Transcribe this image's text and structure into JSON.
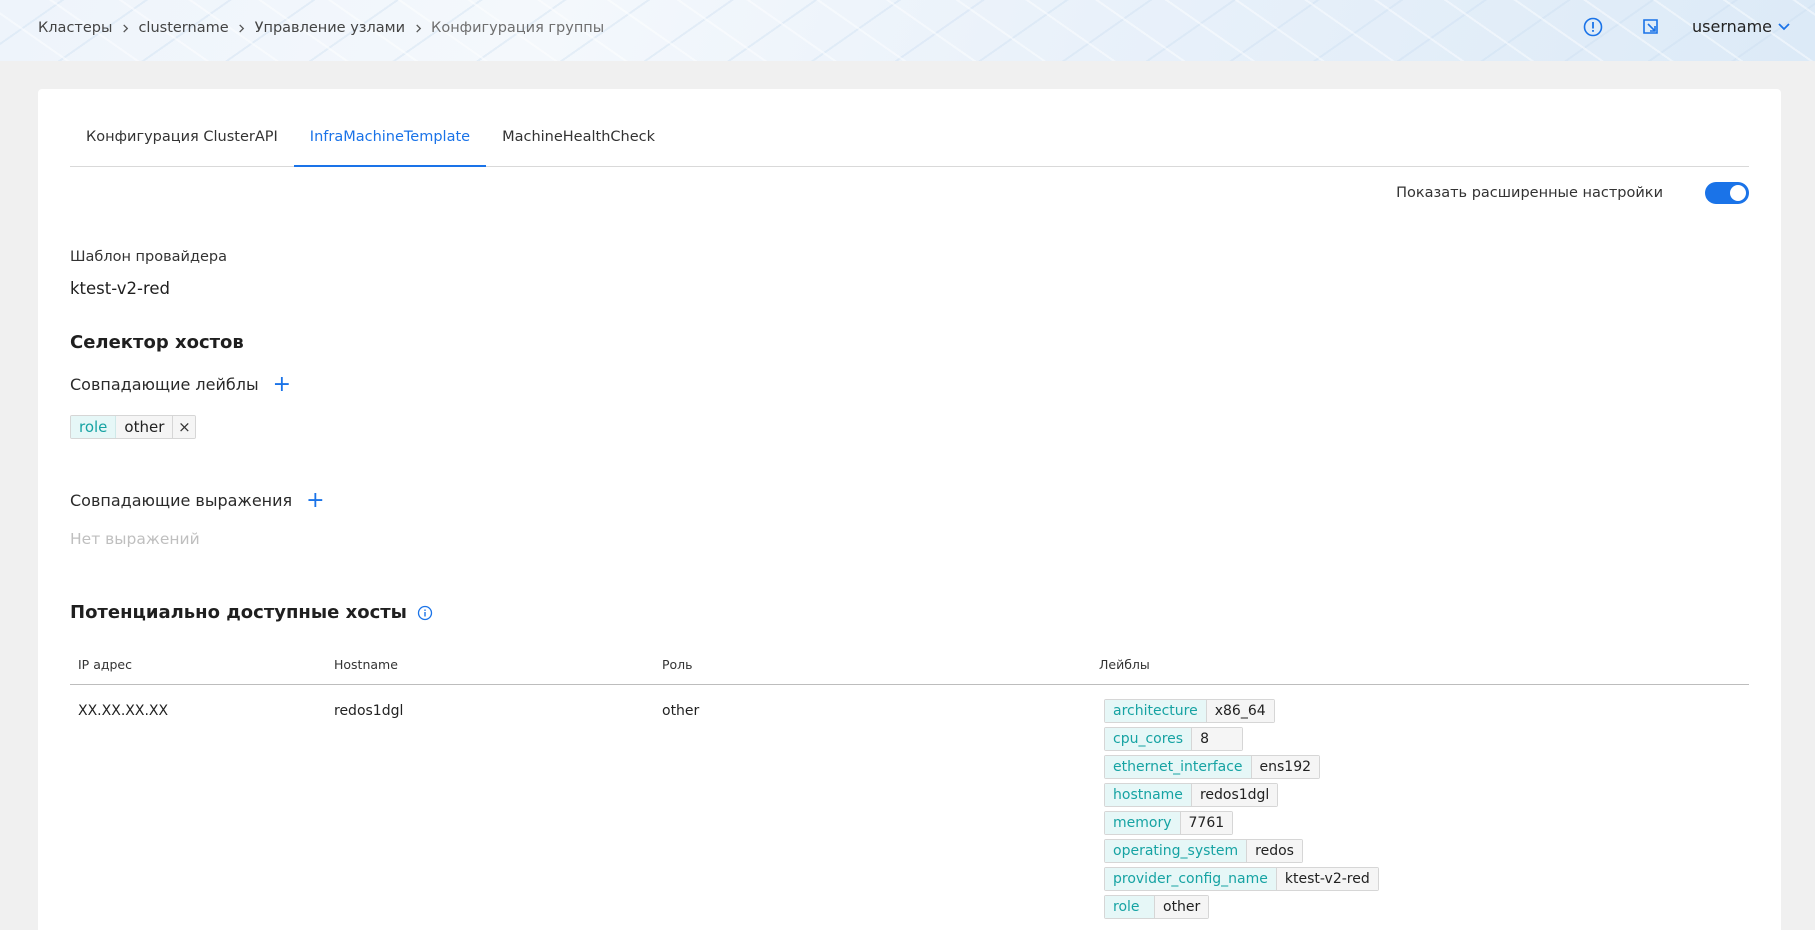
{
  "breadcrumb": [
    "Кластеры",
    "clustername",
    "Управление узлами",
    "Конфигурация группы"
  ],
  "header": {
    "username": "username",
    "alert_icon": "alert-circle-icon",
    "external_icon": "open-external-icon"
  },
  "colors": {
    "accent": "#1a73e8",
    "tag_key_bg": "#e6f7f7",
    "tag_key_text": "#16a3a3"
  },
  "tabs": [
    {
      "label": "Конфигурация ClusterAPI",
      "active": false
    },
    {
      "label": "InfraMachineTemplate",
      "active": true
    },
    {
      "label": "MachineHealthCheck",
      "active": false
    }
  ],
  "advanced_toggle": {
    "label": "Показать расширенные настройки",
    "on": true
  },
  "provider_template": {
    "label": "Шаблон провайдера",
    "value": "ktest-v2-red"
  },
  "host_selector": {
    "title": "Селектор хостов",
    "match_labels": {
      "title": "Совпадающие лейблы",
      "chips": [
        {
          "key": "role",
          "value": "other"
        }
      ]
    },
    "match_expressions": {
      "title": "Совпадающие выражения",
      "empty": "Нет выражений"
    }
  },
  "available_hosts": {
    "title": "Потенциально доступные хосты",
    "columns": [
      "IP адрес",
      "Hostname",
      "Роль",
      "Лейблы"
    ],
    "rows": [
      {
        "ip": "XX.XX.XX.XX",
        "hostname": "redos1dgl",
        "role": "other",
        "labels": [
          {
            "key": "architecture",
            "value": "x86_64"
          },
          {
            "key": "cpu_cores",
            "value": "8"
          },
          {
            "key": "ethernet_interface",
            "value": "ens192"
          },
          {
            "key": "hostname",
            "value": "redos1dgl"
          },
          {
            "key": "memory",
            "value": "7761"
          },
          {
            "key": "operating_system",
            "value": "redos"
          },
          {
            "key": "provider_config_name",
            "value": "ktest-v2-red"
          },
          {
            "key": "role",
            "value": "other"
          }
        ]
      }
    ]
  }
}
